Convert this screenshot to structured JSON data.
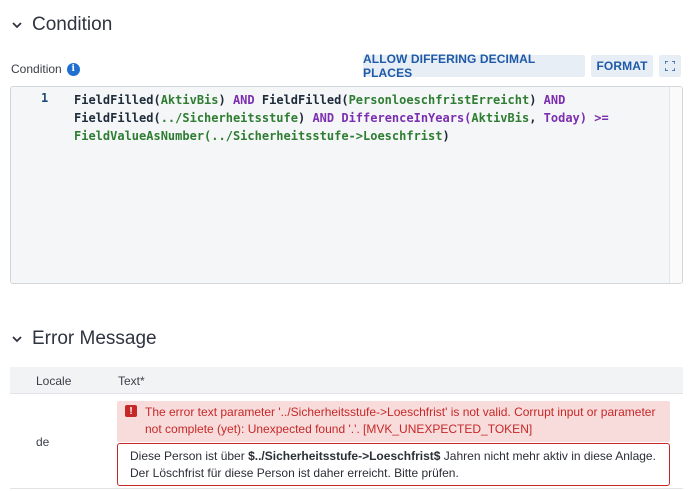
{
  "condition_section": {
    "title": "Condition",
    "field_label": "Condition",
    "buttons": {
      "allow_differing": "ALLOW DIFFERING DECIMAL PLACES",
      "format": "FORMAT"
    },
    "editor": {
      "line_number": "1",
      "lines": [
        [
          {
            "t": "FieldFilled(",
            "c": "fn"
          },
          {
            "t": "AktivBis",
            "c": "arg"
          },
          {
            "t": ") ",
            "c": "p"
          },
          {
            "t": "AND",
            "c": "kw"
          },
          {
            "t": " FieldFilled(",
            "c": "fn"
          },
          {
            "t": "PersonloeschfristErreicht",
            "c": "arg"
          },
          {
            "t": ") ",
            "c": "p"
          },
          {
            "t": "AND",
            "c": "kw"
          }
        ],
        [
          {
            "t": "FieldFilled(",
            "c": "fn"
          },
          {
            "t": "../Sicherheitsstufe",
            "c": "arg"
          },
          {
            "t": ") ",
            "c": "p"
          },
          {
            "t": "AND",
            "c": "kw"
          },
          {
            "t": " DifferenceInYears(",
            "c": "kw"
          },
          {
            "t": "AktivBis",
            "c": "arg"
          },
          {
            "t": ", ",
            "c": "p"
          },
          {
            "t": "Today",
            "c": "kw"
          },
          {
            "t": ") >=",
            "c": "kw"
          }
        ],
        [
          {
            "t": "FieldValueAsNumber(",
            "c": "arg"
          },
          {
            "t": "../Sicherheitsstufe->Loeschfrist",
            "c": "arg"
          },
          {
            "t": ")",
            "c": "p"
          }
        ]
      ]
    }
  },
  "error_section": {
    "title": "Error Message",
    "table": {
      "headers": [
        "Locale",
        "Text*"
      ],
      "rows": [
        {
          "locale": "de",
          "validation_error": "The error text parameter '../Sicherheitsstufe->Loeschfrist' is not valid. Corrupt input or parameter not complete (yet): Unexpected found '.'. [MVK_UNEXPECTED_TOKEN]",
          "text_before": "Diese Person ist über ",
          "text_param": "$../Sicherheitsstufe->Loeschfrist$",
          "text_after": " Jahren nicht mehr aktiv in diese Anlage. Der Löschfrist für diese Person ist daher erreicht. Bitte prüfen."
        }
      ]
    }
  },
  "icons": {
    "collapse": "chevron-down-icon",
    "info": "info-icon",
    "expand": "expand-icon",
    "error": "error-icon"
  },
  "colors": {
    "accent": "#1e5aa8",
    "error": "#c62828",
    "error_bg": "#f8dcdc",
    "code_keyword": "#7b2fb0",
    "code_argument": "#2e7d32"
  }
}
